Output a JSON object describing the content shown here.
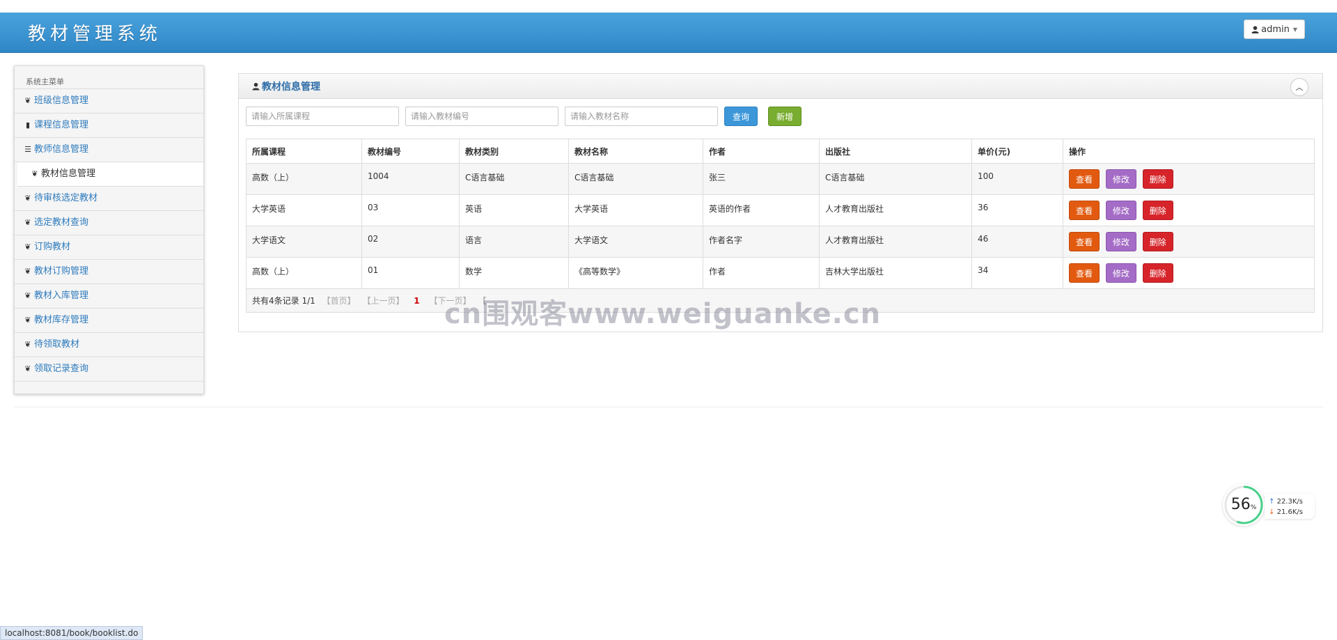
{
  "header": {
    "app_title": "教材管理系统",
    "user_label": "admin",
    "brand_color": "#3893d0"
  },
  "sidebar": {
    "header": "系统主菜单",
    "items": [
      {
        "label": "班级信息管理",
        "icon": "leaf-icon"
      },
      {
        "label": "课程信息管理",
        "icon": "bookmark-icon"
      },
      {
        "label": "教师信息管理",
        "icon": "list-icon"
      },
      {
        "label": "教材信息管理",
        "icon": "leaf-icon"
      },
      {
        "label": "待审核选定教材",
        "icon": "leaf-icon"
      },
      {
        "label": "选定教材查询",
        "icon": "leaf-icon"
      },
      {
        "label": "订购教材",
        "icon": "leaf-icon"
      },
      {
        "label": "教材订购管理",
        "icon": "leaf-icon"
      },
      {
        "label": "教材入库管理",
        "icon": "leaf-icon"
      },
      {
        "label": "教材库存管理",
        "icon": "leaf-icon"
      },
      {
        "label": "待领取教材",
        "icon": "leaf-icon"
      },
      {
        "label": "领取记录查询",
        "icon": "leaf-icon"
      }
    ]
  },
  "panel": {
    "title": "教材信息管理",
    "search": {
      "course_placeholder": "请输入所属课程",
      "code_placeholder": "请输入教材编号",
      "name_placeholder": "请输入教材名称",
      "query_label": "查询",
      "add_label": "新增"
    },
    "table": {
      "headers": [
        "所属课程",
        "教材编号",
        "教材类别",
        "教材名称",
        "作者",
        "出版社",
        "单价(元)",
        "操作"
      ],
      "rows": [
        [
          "高数（上）",
          "1004",
          "C语言基础",
          "C语言基础",
          "张三",
          "C语言基础",
          "100"
        ],
        [
          "大学英语",
          "03",
          "英语",
          "大学英语",
          "英语的作者",
          "人才教育出版社",
          "36"
        ],
        [
          "大学语文",
          "02",
          "语言",
          "大学语文",
          "作者名字",
          "人才教育出版社",
          "46"
        ],
        [
          "高数（上）",
          "01",
          "数学",
          "《高等数学》",
          "作者",
          "吉林大学出版社",
          "34"
        ]
      ],
      "actions": {
        "view": "查看",
        "edit": "修改",
        "delete": "删除"
      }
    },
    "pager": {
      "summary": "共有4条记录 1/1",
      "first": "【首页】",
      "prev": "【上一页】",
      "current": "1",
      "next": "【下一页】",
      "last": "【"
    }
  },
  "watermark": "cn围观客www.weiguanke.cn",
  "netmon": {
    "percent": "56",
    "percent_sign": "%",
    "percent_value": 56,
    "upload": "22.3K/s",
    "download": "21.6K/s"
  },
  "status_url": "localhost:8081/book/booklist.do"
}
